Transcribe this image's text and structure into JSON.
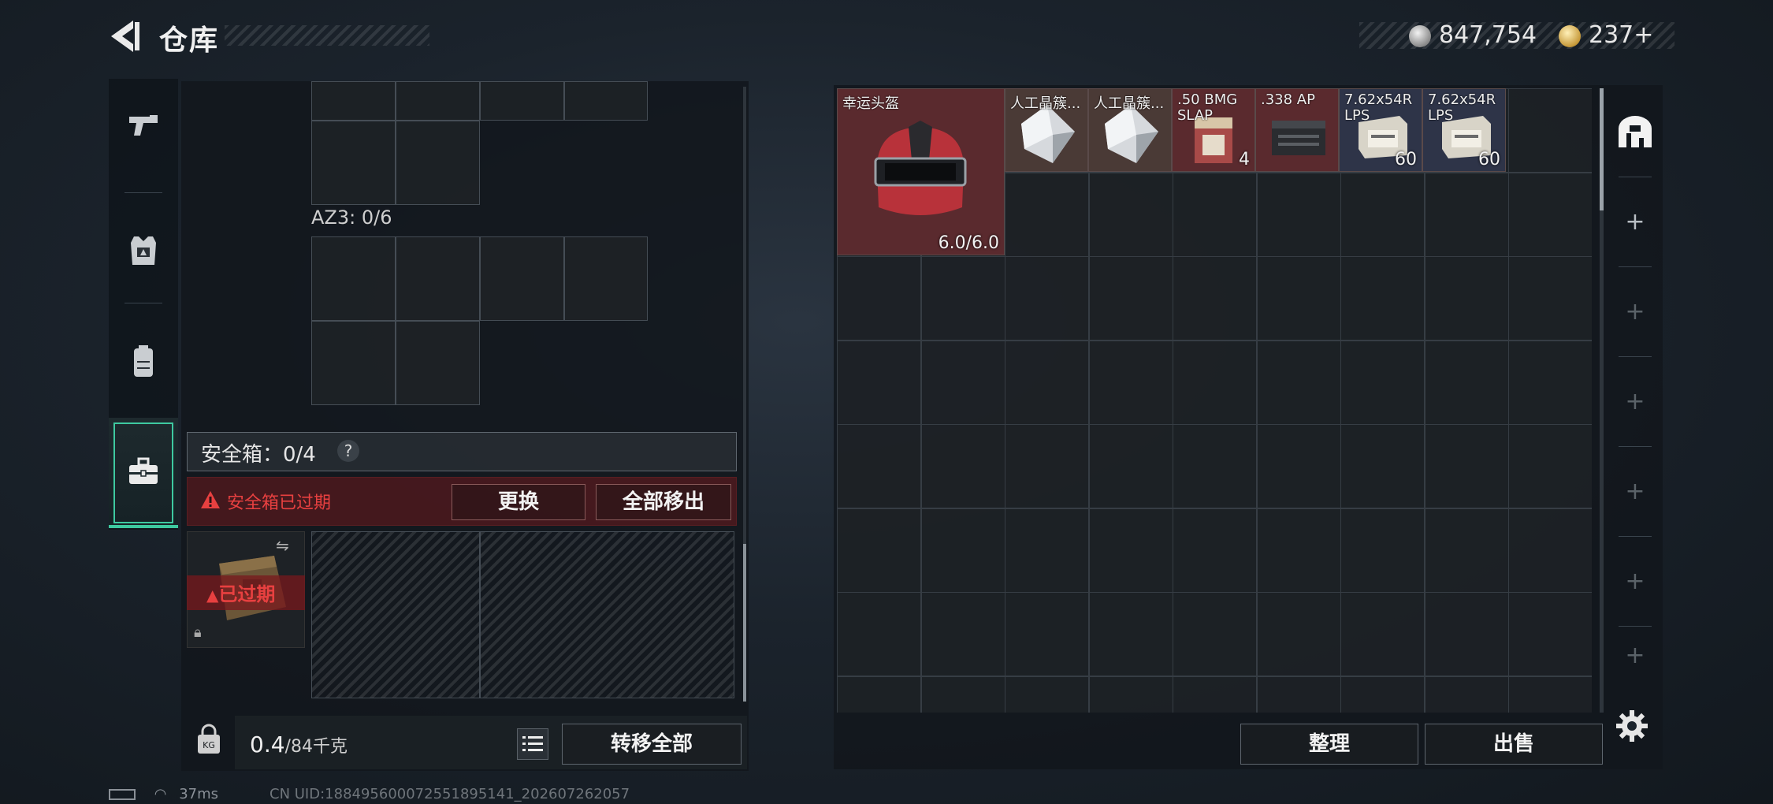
{
  "header": {
    "title": "仓库",
    "back_icon": "back-arrow-icon",
    "currency": {
      "silver_icon": "silver-coin-icon",
      "silver_value": "847,754",
      "gold_icon": "gold-coin-icon",
      "gold_value": "237+"
    }
  },
  "sidebar": {
    "items": [
      {
        "icon": "pistol-icon"
      },
      {
        "icon": "vest-icon"
      },
      {
        "icon": "backpack-icon"
      },
      {
        "icon": "briefcase-icon",
        "active": true
      }
    ]
  },
  "left_panel": {
    "az3_label": "AZ3: 0/6",
    "safe_box": {
      "label": "安全箱：0/4",
      "help": "?",
      "warning": "安全箱已过期",
      "replace_label": "更换",
      "remove_all_label": "全部移出",
      "case_expired_label": "已过期"
    },
    "weight": {
      "value": "0.4",
      "max": "/84千克",
      "lock_label": "KG"
    },
    "transfer_all_label": "转移全部"
  },
  "inventory": {
    "items": [
      {
        "name": "幸运头盔",
        "count": "6.0/6.0",
        "tone": "red"
      },
      {
        "name": "人工晶簇...",
        "count": "",
        "tone": "brown"
      },
      {
        "name": "人工晶簇...",
        "count": "",
        "tone": "brown"
      },
      {
        "name": ".50 BMG SLAP",
        "count": "4",
        "tone": "red"
      },
      {
        "name": ".338 AP",
        "count": "",
        "tone": "red"
      },
      {
        "name": "7.62x54R LPS",
        "count": "60",
        "tone": "navy"
      },
      {
        "name": "7.62x54R LPS",
        "count": "60",
        "tone": "navy"
      }
    ],
    "sort_label": "整理",
    "sell_label": "出售"
  },
  "right_rail": {
    "top_icon": "container-icon",
    "add_symbol": "+"
  },
  "status_bar": {
    "ping": "37ms",
    "uid": "CN UID:1884956000725518951​41_202607262057"
  },
  "colors": {
    "accent": "#3ec9a0",
    "warning": "#e84040",
    "item_red": "#5a2a2e",
    "item_navy": "#2e3448"
  }
}
